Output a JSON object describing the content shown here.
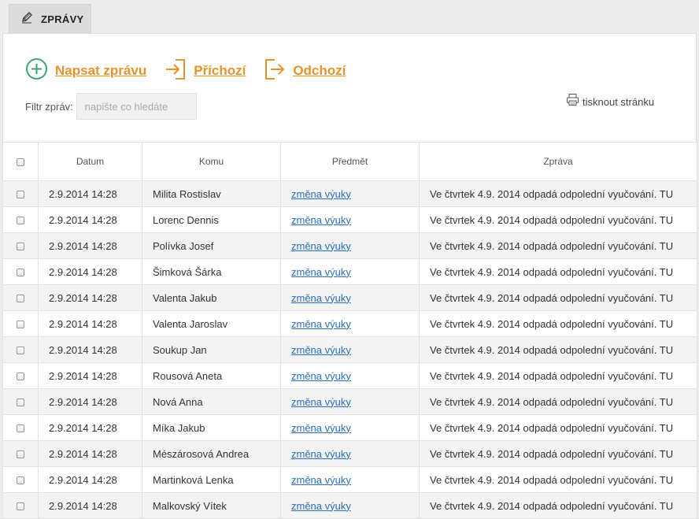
{
  "tab": {
    "label": "ZPRÁVY",
    "icon": "pencil-icon"
  },
  "actions": {
    "new_message": "Napsat zprávu",
    "inbox": "Příchozí",
    "outbox": "Odchozí"
  },
  "filter": {
    "label": "Filtr zpráv:",
    "placeholder": "napište co hledáte"
  },
  "print": {
    "label": "tisknout stránku",
    "icon": "printer-icon"
  },
  "colors": {
    "accent": "#e8922a",
    "link": "#2a6fb8",
    "new_icon": "#3aa676",
    "row_alt": "#f3f3f3"
  },
  "table": {
    "headers": {
      "datum": "Datum",
      "komu": "Komu",
      "predmet": "Předmět",
      "zprava": "Zpráva"
    },
    "rows": [
      {
        "datum": "2.9.2014 14:28",
        "komu": "Milita Rostislav",
        "predmet": "změna výuky",
        "zprava": "Ve čtvrtek 4.9. 2014 odpadá odpolední vyučování. TU"
      },
      {
        "datum": "2.9.2014 14:28",
        "komu": "Lorenc Dennis",
        "predmet": "změna výuky",
        "zprava": "Ve čtvrtek 4.9. 2014 odpadá odpolední vyučování. TU"
      },
      {
        "datum": "2.9.2014 14:28",
        "komu": "Polívka Josef",
        "predmet": "změna výuky",
        "zprava": "Ve čtvrtek 4.9. 2014 odpadá odpolední vyučování. TU"
      },
      {
        "datum": "2.9.2014 14:28",
        "komu": "Šimková Šárka",
        "predmet": "změna výuky",
        "zprava": "Ve čtvrtek 4.9. 2014 odpadá odpolední vyučování. TU"
      },
      {
        "datum": "2.9.2014 14:28",
        "komu": "Valenta Jakub",
        "predmet": "změna výuky",
        "zprava": "Ve čtvrtek 4.9. 2014 odpadá odpolední vyučování. TU"
      },
      {
        "datum": "2.9.2014 14:28",
        "komu": "Valenta Jaroslav",
        "predmet": "změna výuky",
        "zprava": "Ve čtvrtek 4.9. 2014 odpadá odpolední vyučování. TU"
      },
      {
        "datum": "2.9.2014 14:28",
        "komu": "Soukup Jan",
        "predmet": "změna výuky",
        "zprava": "Ve čtvrtek 4.9. 2014 odpadá odpolední vyučování. TU"
      },
      {
        "datum": "2.9.2014 14:28",
        "komu": "Rousová Aneta",
        "predmet": "změna výuky",
        "zprava": "Ve čtvrtek 4.9. 2014 odpadá odpolední vyučování. TU"
      },
      {
        "datum": "2.9.2014 14:28",
        "komu": "Nová Anna",
        "predmet": "změna výuky",
        "zprava": "Ve čtvrtek 4.9. 2014 odpadá odpolední vyučování. TU"
      },
      {
        "datum": "2.9.2014 14:28",
        "komu": "Míka Jakub",
        "predmet": "změna výuky",
        "zprava": "Ve čtvrtek 4.9. 2014 odpadá odpolední vyučování. TU"
      },
      {
        "datum": "2.9.2014 14:28",
        "komu": "Mészárosová Andrea",
        "predmet": "změna výuky",
        "zprava": "Ve čtvrtek 4.9. 2014 odpadá odpolední vyučování. TU"
      },
      {
        "datum": "2.9.2014 14:28",
        "komu": "Martinková Lenka",
        "predmet": "změna výuky",
        "zprava": "Ve čtvrtek 4.9. 2014 odpadá odpolední vyučování. TU"
      },
      {
        "datum": "2.9.2014 14:28",
        "komu": "Malkovský Vítek",
        "predmet": "změna výuky",
        "zprava": "Ve čtvrtek 4.9. 2014 odpadá odpolední vyučování. TU"
      }
    ]
  }
}
